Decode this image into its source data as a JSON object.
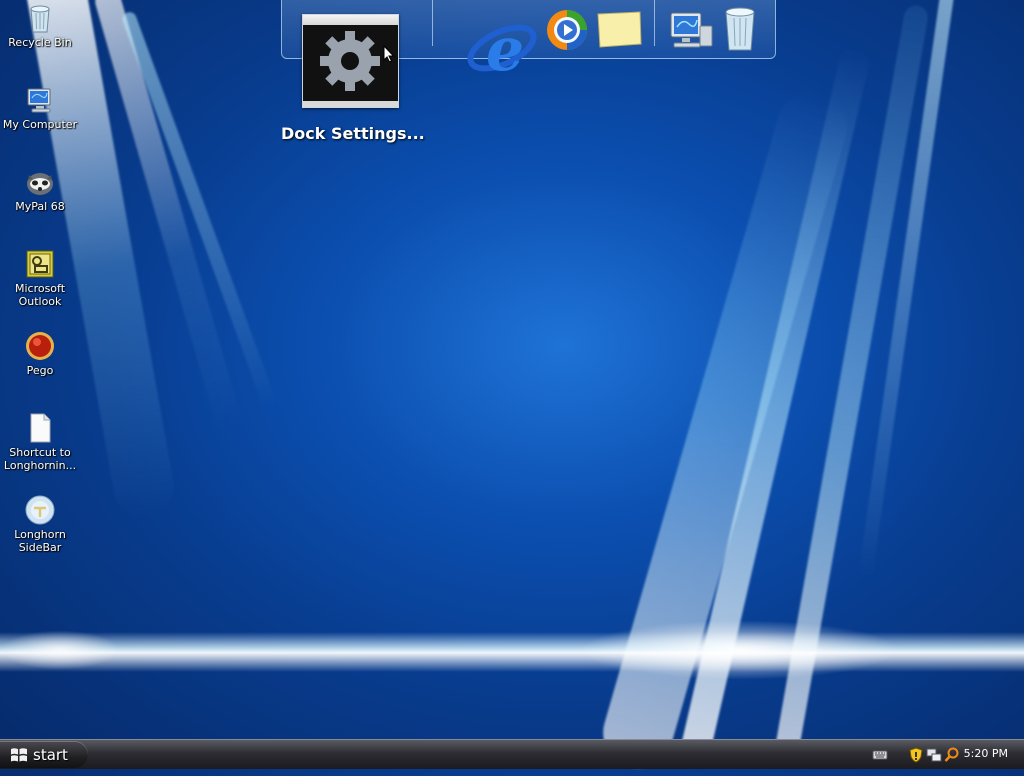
{
  "desktop": {
    "icons": [
      {
        "label": "Recycle Bin",
        "icon": "recycle-bin-icon"
      },
      {
        "label": "My Computer",
        "icon": "my-computer-icon"
      },
      {
        "label": "MyPal 68",
        "icon": "mypal-icon"
      },
      {
        "label": "Microsoft Outlook",
        "icon": "outlook-icon"
      },
      {
        "label": "Pego",
        "icon": "pego-icon"
      },
      {
        "label": "Shortcut to Longhornin...",
        "icon": "shortcut-file-icon"
      },
      {
        "label": "Longhorn SideBar",
        "icon": "sidebar-icon"
      }
    ]
  },
  "dock": {
    "tooltip": "Dock Settings...",
    "items": [
      {
        "icon": "dock-settings-gear-icon"
      },
      {
        "icon": "internet-explorer-icon"
      },
      {
        "icon": "media-player-icon"
      },
      {
        "icon": "sticky-notes-icon"
      },
      {
        "icon": "my-computer-icon"
      },
      {
        "icon": "recycle-bin-icon"
      }
    ]
  },
  "taskbar": {
    "start_label": "start",
    "clock": "5:20 PM",
    "tray_icons": [
      "keyboard-icon",
      "security-shield-icon",
      "network-icon",
      "search-icon"
    ]
  },
  "colors": {
    "wallpaper": "#0b4fb0",
    "taskbar": "#2d2d33"
  }
}
